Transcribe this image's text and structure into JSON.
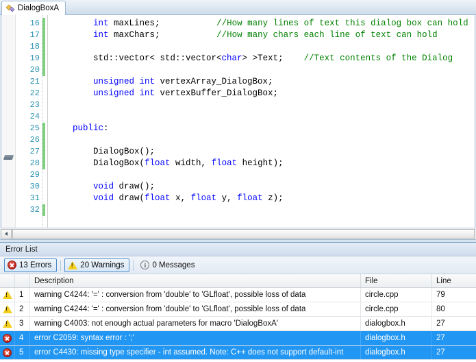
{
  "editor": {
    "tab": {
      "label": "DialogBoxA",
      "icon": "cpp-header-file-icon"
    },
    "first_line_number": 16,
    "lines": [
      {
        "num": 16,
        "changed": true,
        "tokens": [
          {
            "t": "        ",
            "c": "txt"
          },
          {
            "t": "int",
            "c": "kw"
          },
          {
            "t": " maxLines;           ",
            "c": "txt"
          },
          {
            "t": "//How many lines of text this dialog box can hold",
            "c": "cmt"
          }
        ]
      },
      {
        "num": 17,
        "changed": true,
        "tokens": [
          {
            "t": "        ",
            "c": "txt"
          },
          {
            "t": "int",
            "c": "kw"
          },
          {
            "t": " maxChars;           ",
            "c": "txt"
          },
          {
            "t": "//How many chars each line of text can hold",
            "c": "cmt"
          }
        ]
      },
      {
        "num": 18,
        "changed": true,
        "tokens": []
      },
      {
        "num": 19,
        "changed": true,
        "tokens": [
          {
            "t": "        std::vector< std::vector<",
            "c": "txt"
          },
          {
            "t": "char",
            "c": "kw"
          },
          {
            "t": "> >Text;    ",
            "c": "txt"
          },
          {
            "t": "//Text contents of the Dialog",
            "c": "cmt"
          }
        ]
      },
      {
        "num": 20,
        "changed": true,
        "tokens": []
      },
      {
        "num": 21,
        "changed": false,
        "tokens": [
          {
            "t": "        ",
            "c": "txt"
          },
          {
            "t": "unsigned int",
            "c": "kw"
          },
          {
            "t": " vertexArray_DialogBox;",
            "c": "txt"
          }
        ]
      },
      {
        "num": 22,
        "changed": false,
        "tokens": [
          {
            "t": "        ",
            "c": "txt"
          },
          {
            "t": "unsigned int",
            "c": "kw"
          },
          {
            "t": " vertexBuffer_DialogBox;",
            "c": "txt"
          }
        ]
      },
      {
        "num": 23,
        "changed": false,
        "tokens": []
      },
      {
        "num": 24,
        "changed": false,
        "tokens": []
      },
      {
        "num": 25,
        "changed": true,
        "tokens": [
          {
            "t": "    ",
            "c": "txt"
          },
          {
            "t": "public",
            "c": "kw"
          },
          {
            "t": ":",
            "c": "txt"
          }
        ]
      },
      {
        "num": 26,
        "changed": true,
        "tokens": []
      },
      {
        "num": 27,
        "changed": true,
        "tokens": [
          {
            "t": "        DialogBox();",
            "c": "txt"
          }
        ]
      },
      {
        "num": 28,
        "changed": true,
        "tokens": [
          {
            "t": "        DialogBox(",
            "c": "txt"
          },
          {
            "t": "float",
            "c": "kw"
          },
          {
            "t": " width, ",
            "c": "txt"
          },
          {
            "t": "float",
            "c": "kw"
          },
          {
            "t": " height);",
            "c": "txt"
          }
        ]
      },
      {
        "num": 29,
        "changed": false,
        "tokens": []
      },
      {
        "num": 30,
        "changed": false,
        "tokens": [
          {
            "t": "        ",
            "c": "txt"
          },
          {
            "t": "void",
            "c": "kw"
          },
          {
            "t": " draw();",
            "c": "txt"
          }
        ]
      },
      {
        "num": 31,
        "changed": false,
        "tokens": [
          {
            "t": "        ",
            "c": "txt"
          },
          {
            "t": "void",
            "c": "kw"
          },
          {
            "t": " draw(",
            "c": "txt"
          },
          {
            "t": "float",
            "c": "kw"
          },
          {
            "t": " x, ",
            "c": "txt"
          },
          {
            "t": "float",
            "c": "kw"
          },
          {
            "t": " y, ",
            "c": "txt"
          },
          {
            "t": "float",
            "c": "kw"
          },
          {
            "t": " z);",
            "c": "txt"
          }
        ]
      },
      {
        "num": 32,
        "changed": true,
        "tokens": []
      }
    ],
    "scroll": {
      "left_arrow": "scroll-left-arrow-icon"
    }
  },
  "error_list": {
    "title": "Error List",
    "filters": [
      {
        "label": "13 Errors",
        "icon": "error-icon",
        "active": true
      },
      {
        "label": "20 Warnings",
        "icon": "warning-icon",
        "active": true
      },
      {
        "label": "0 Messages",
        "icon": "info-icon",
        "active": false
      }
    ],
    "columns": [
      "",
      "",
      "Description",
      "File",
      "Line"
    ],
    "rows": [
      {
        "severity": "warning",
        "num": "1",
        "description": "warning C4244: '=' : conversion from 'double' to 'GLfloat', possible loss of data",
        "file": "circle.cpp",
        "line": "79",
        "selected": false
      },
      {
        "severity": "warning",
        "num": "2",
        "description": "warning C4244: '=' : conversion from 'double' to 'GLfloat', possible loss of data",
        "file": "circle.cpp",
        "line": "80",
        "selected": false
      },
      {
        "severity": "warning",
        "num": "3",
        "description": "warning C4003: not enough actual parameters for macro 'DialogBoxA'",
        "file": "dialogbox.h",
        "line": "27",
        "selected": false
      },
      {
        "severity": "error",
        "num": "4",
        "description": "error C2059: syntax error : ';'",
        "file": "dialogbox.h",
        "line": "27",
        "selected": true
      },
      {
        "severity": "error",
        "num": "5",
        "description": "error C4430: missing type specifier - int assumed. Note: C++ does not support default-int",
        "file": "dialogbox.h",
        "line": "27",
        "selected": true
      }
    ]
  },
  "colors": {
    "selection_blue": "#2196f3",
    "keyword_blue": "#0000ff",
    "comment_green": "#008000",
    "linenumber_teal": "#2b91af",
    "changebar_green": "#7ed07e"
  }
}
